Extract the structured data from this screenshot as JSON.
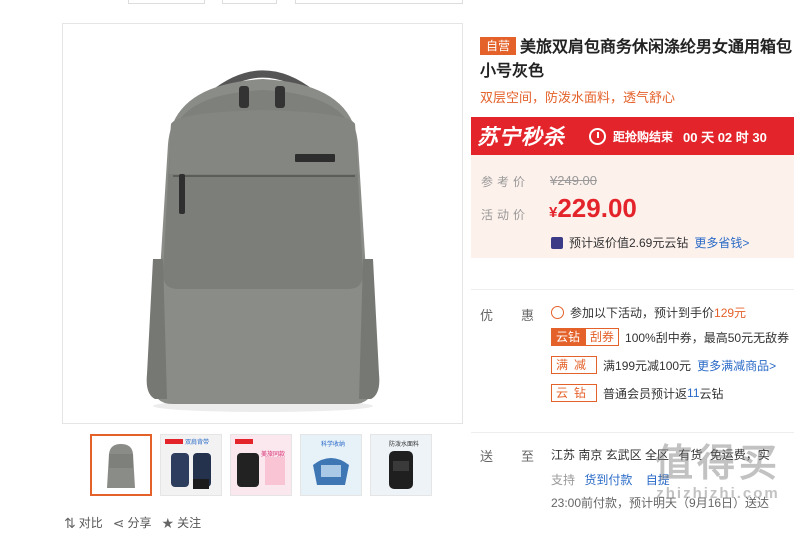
{
  "product": {
    "badge": "自营",
    "title_line1": "美旅双肩包商务休闲涤纶男女通用箱包",
    "title_line2": "小号灰色",
    "subtitle": "双层空间，防泼水面料，透气舒心"
  },
  "flash_sale": {
    "logo": "苏宁秒杀",
    "countdown_label": "距抢购结束",
    "countdown_value": "00 天 02 时 30"
  },
  "price": {
    "ref_label": "参考价",
    "ref_value": "¥249.00",
    "sale_label": "活动价",
    "currency": "¥",
    "sale_value": "229.00",
    "rebate_text": "预计返价值2.69元云钻",
    "rebate_link": "更多省钱>"
  },
  "promo": {
    "label": "优惠",
    "line1_text": "参加以下活动，预计到手价",
    "line1_price": "129元",
    "tag_yunzuan": "云钻",
    "tag_guaquan": "刮券",
    "line2_text": "100%刮中券，最高50元无敌券",
    "tag_manjian": "满减",
    "line3_text": "满199元减100元",
    "line3_link": "更多满减商品>",
    "tag_yunzuan2": "云钻",
    "line4_text": "普通会员预计返",
    "line4_num": "11",
    "line4_suffix": "云钻"
  },
  "shipping": {
    "label": "送至",
    "address": "江苏 南京 玄武区 全区",
    "stock": "有货",
    "freight": "免运费，实",
    "support_label": "支持",
    "support_link": "货到付款",
    "support_extra": "自提",
    "delivery": "23:00前付款，预计明天（9月16日）送达"
  },
  "actions": {
    "compare": "对比",
    "share": "分享",
    "follow": "关注"
  },
  "thumbs": [
    {
      "caption": ""
    },
    {
      "caption": "双肩背带"
    },
    {
      "caption": "美旅同款"
    },
    {
      "caption": "科学收纳"
    },
    {
      "caption": "防泼水面料"
    }
  ],
  "watermark": {
    "big": "值得买",
    "small": "zhizhizhi.com"
  },
  "colors": {
    "accent": "#e4612a",
    "flash_red": "#e4242b",
    "link": "#2a6ac7"
  }
}
